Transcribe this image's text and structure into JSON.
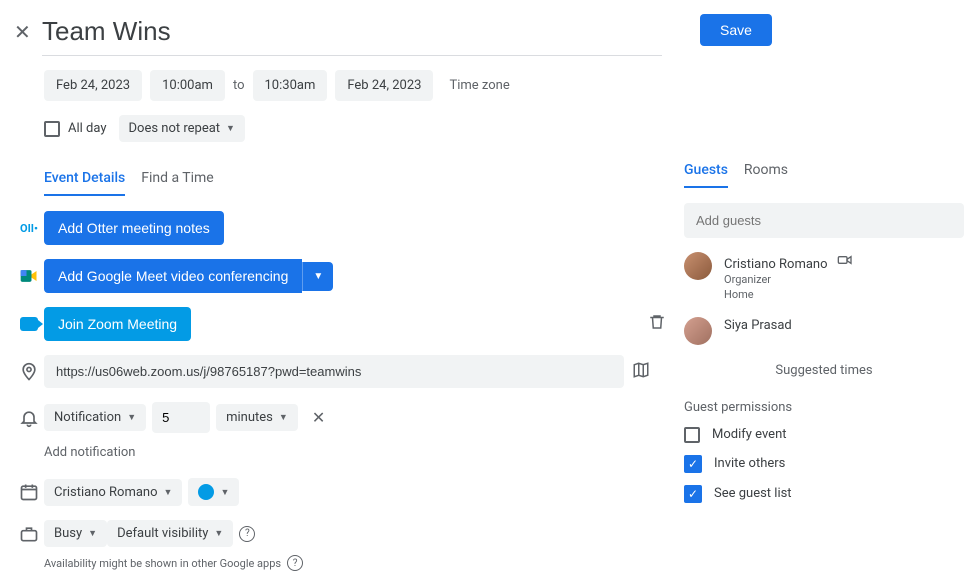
{
  "header": {
    "title": "Team Wins",
    "save": "Save"
  },
  "datetime": {
    "start_date": "Feb 24, 2023",
    "start_time": "10:00am",
    "to": "to",
    "end_time": "10:30am",
    "end_date": "Feb 24, 2023",
    "timezone": "Time zone",
    "all_day": "All day",
    "repeat": "Does not repeat"
  },
  "tabs": {
    "details": "Event Details",
    "find": "Find a Time"
  },
  "buttons": {
    "otter": "Add Otter meeting notes",
    "meet": "Add Google Meet video conferencing",
    "zoom": "Join Zoom Meeting"
  },
  "location": {
    "url": "https://us06web.zoom.us/j/98765187?pwd=teamwins"
  },
  "notification": {
    "type": "Notification",
    "value": "5",
    "unit": "minutes",
    "add": "Add notification"
  },
  "calendar": {
    "owner": "Cristiano Romano"
  },
  "availability": {
    "busy": "Busy",
    "visibility": "Default visibility",
    "note": "Availability might be shown in other Google apps"
  },
  "right_tabs": {
    "guests": "Guests",
    "rooms": "Rooms"
  },
  "guests": {
    "placeholder": "Add guests",
    "list": [
      {
        "name": "Cristiano Romano",
        "role": "Organizer",
        "location": "Home"
      },
      {
        "name": "Siya Prasad",
        "role": "",
        "location": ""
      }
    ],
    "suggested": "Suggested times"
  },
  "permissions": {
    "title": "Guest permissions",
    "modify": "Modify event",
    "invite": "Invite others",
    "see": "See guest list"
  }
}
